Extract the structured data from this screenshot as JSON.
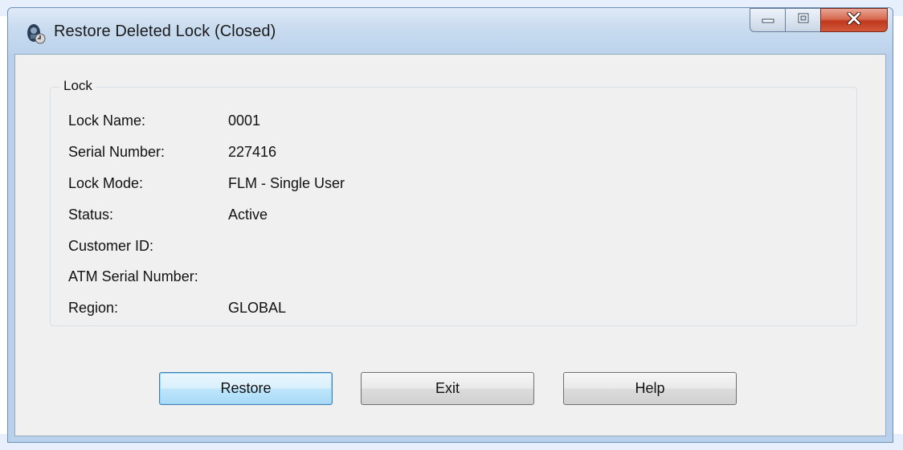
{
  "window": {
    "title": "Restore Deleted Lock (Closed)",
    "icon": "lock-app-icon"
  },
  "caption": {
    "minimize_icon": "minimize-icon",
    "maximize_icon": "maximize-icon",
    "close_icon": "close-icon"
  },
  "group": {
    "legend": "Lock"
  },
  "fields": [
    {
      "label": "Lock Name:",
      "value": "0001"
    },
    {
      "label": "Serial Number:",
      "value": "227416"
    },
    {
      "label": "Lock Mode:",
      "value": "FLM - Single User"
    },
    {
      "label": "Status:",
      "value": "Active"
    },
    {
      "label": "Customer ID:",
      "value": ""
    },
    {
      "label": "ATM Serial Number:",
      "value": ""
    },
    {
      "label": "Region:",
      "value": "GLOBAL"
    }
  ],
  "buttons": {
    "restore": "Restore",
    "exit": "Exit",
    "help": "Help"
  },
  "colors": {
    "close_button": "#c0381c",
    "default_button_border": "#3c7fb1",
    "client_background": "#f0f0f0",
    "frame": "#b9d1ea"
  }
}
